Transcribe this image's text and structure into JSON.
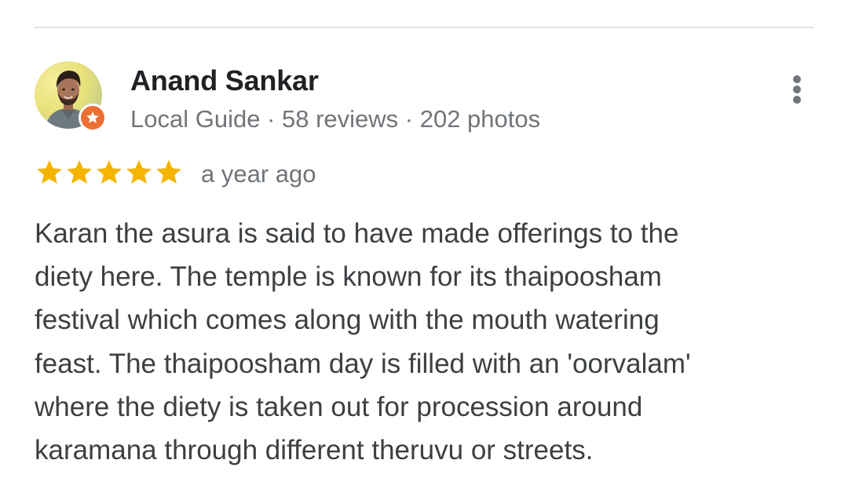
{
  "reviewer": {
    "name": "Anand Sankar",
    "meta": "Local Guide · 58 reviews · 202 photos",
    "badge_color": "#ee6f34"
  },
  "review": {
    "rating": 5,
    "rating_max": 5,
    "star_color": "#f4b400",
    "date": "a year ago",
    "lines": [
      "Karan the asura is said to have made offerings to the",
      "diety here. The temple is known for its thaipoosham",
      "festival which comes along with the mouth watering",
      "feast. The thaipoosham day is filled with an 'oorvalam'",
      "where the diety is taken out for procession around",
      "karamana through different theruvu or streets."
    ]
  },
  "icons": {
    "more": "more-vert-icon",
    "badge": "local-guide-star-icon",
    "star": "star-icon"
  }
}
